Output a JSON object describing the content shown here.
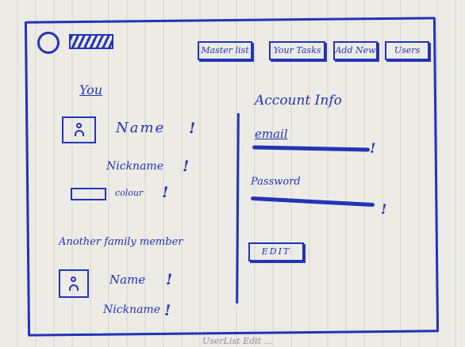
{
  "nav": {
    "master_list": "Master list",
    "your_tasks": "Your Tasks",
    "add_new": "Add New",
    "users": "Users"
  },
  "you": {
    "heading": "You",
    "name": "Name",
    "nickname": "Nickname",
    "colour": "colour"
  },
  "account": {
    "heading": "Account Info",
    "email_label": "email",
    "password_label": "Password",
    "edit_label": "EDIT"
  },
  "family": {
    "heading": "Another family member",
    "name": "Name",
    "nickname": "Nickname"
  },
  "marks": {
    "required": "!"
  },
  "caption": "UserList Edit ..."
}
